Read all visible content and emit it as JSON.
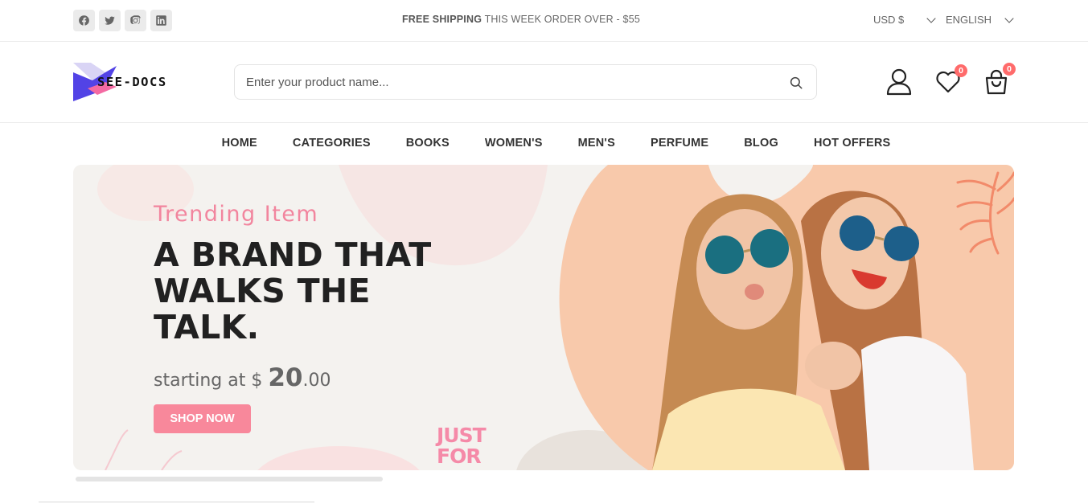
{
  "topbar": {
    "socials": [
      "facebook-icon",
      "twitter-icon",
      "instagram-icon",
      "linkedin-icon"
    ],
    "promo_bold": "FREE SHIPPING",
    "promo_rest": " THIS WEEK ORDER OVER - $55",
    "currency": "USD $",
    "language": "ENGLISH"
  },
  "header": {
    "logo_text": "SEE-DOCS",
    "search_placeholder": "Enter your product name...",
    "wishlist_count": "0",
    "cart_count": "0"
  },
  "nav": {
    "items": [
      "HOME",
      "CATEGORIES",
      "BOOKS",
      "WOMEN'S",
      "MEN'S",
      "PERFUME",
      "BLOG",
      "HOT OFFERS"
    ]
  },
  "banner": {
    "subtitle": "Trending Item",
    "headline_1": "A BRAND THAT",
    "headline_2": "WALKS THE",
    "headline_3": "TALK.",
    "price_prefix": "starting at $ ",
    "price_main": "20",
    "price_cents": ".00",
    "button": "SHOP NOW",
    "sticker_1": "JUST",
    "sticker_2": "FOR"
  },
  "colors": {
    "accent": "#f8889b",
    "badge": "#ff6b6b",
    "banner_bg": "#f4f2ef",
    "photo_bg": "#f8c9ab"
  }
}
